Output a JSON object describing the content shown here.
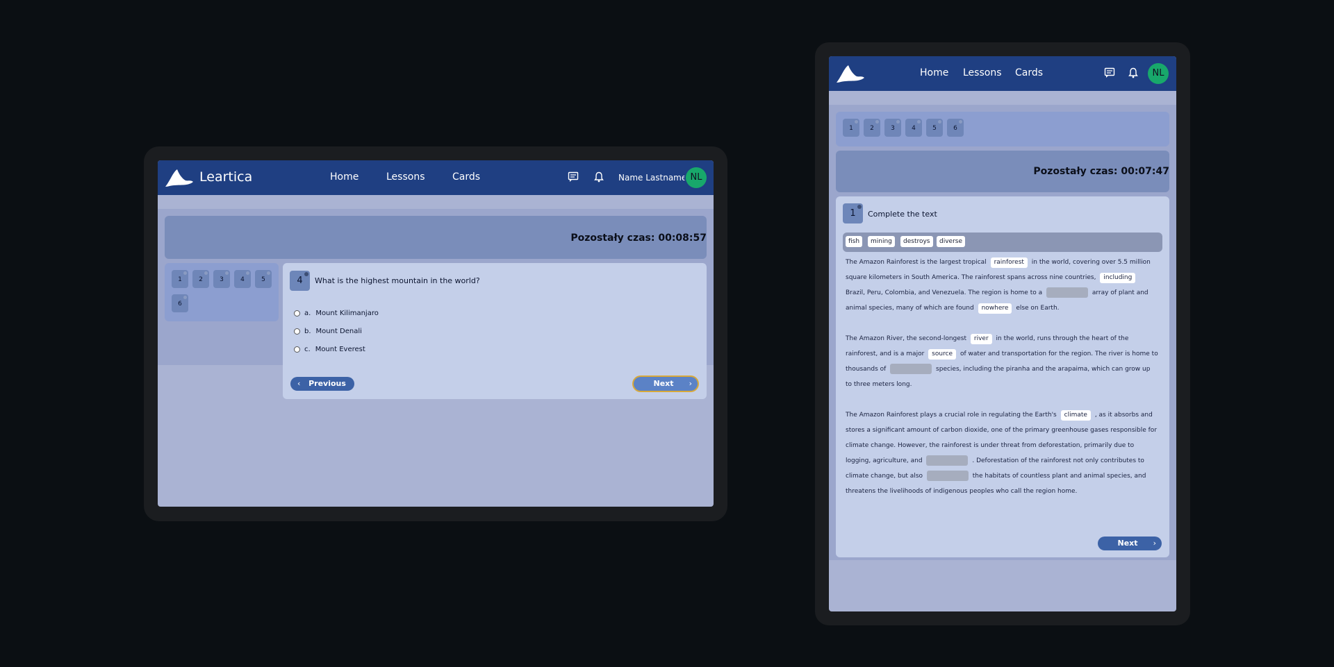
{
  "colors": {
    "navbar": "#1f3f82",
    "accent_button": "#3c62a6",
    "avatar": "#18a86b",
    "focus_outline": "#d8a93a"
  },
  "left": {
    "nav": {
      "brand": "Leartica",
      "links": [
        "Home",
        "Lessons",
        "Cards"
      ],
      "username": "Name Lastname",
      "avatar_initials": "NL"
    },
    "timer": "Pozostały czas: 00:08:57",
    "questions": [
      "1",
      "2",
      "3",
      "4",
      "5",
      "6"
    ],
    "current": {
      "number": "4",
      "text": "What is the highest mountain in the world?"
    },
    "options": [
      {
        "letter": "a.",
        "text": "Mount Kilimanjaro"
      },
      {
        "letter": "b.",
        "text": "Mount Denali"
      },
      {
        "letter": "c.",
        "text": "Mount Everest"
      }
    ],
    "prev_label": "Previous",
    "next_label": "Next"
  },
  "right": {
    "nav": {
      "links": [
        "Home",
        "Lessons",
        "Cards"
      ],
      "avatar_initials": "NL"
    },
    "questions": [
      "1",
      "2",
      "3",
      "4",
      "5",
      "6"
    ],
    "timer": "Pozostały czas: 00:07:47",
    "current": {
      "number": "1",
      "text": "Complete the text"
    },
    "word_bank": [
      "fish",
      "mining",
      "destroys",
      "diverse"
    ],
    "paragraph1": {
      "t1": "The Amazon Rainforest is the largest tropical",
      "f1": "rainforest",
      "t2": "in the world, covering over 5.5 million square kilometers in South America. The rainforest spans across nine countries,",
      "f2": "including",
      "t3": "Brazil, Peru, Colombia, and Venezuela. The region is home to a",
      "t4": "array of plant and animal species, many of which are found",
      "f3": "nowhere",
      "t5": "else on Earth."
    },
    "paragraph2": {
      "t1": "The Amazon River, the second-longest",
      "f1": "river",
      "t2": "in the world, runs through the heart of the rainforest, and is a major",
      "f2": "source",
      "t3": "of water and transportation for the region. The river is home to thousands of",
      "t4": "species, including the piranha and the arapaima, which can grow up to three meters long."
    },
    "paragraph3": {
      "t1": "The Amazon Rainforest plays a crucial role in regulating the Earth's",
      "f1": "climate",
      "t2": ", as it absorbs and stores a significant amount of carbon dioxide, one of the primary greenhouse gases responsible for climate change. However, the rainforest is under threat from deforestation, primarily due to logging, agriculture, and",
      "t3": ". Deforestation of the rainforest not only contributes to climate change, but also",
      "t4": "the habitats of countless plant and animal species, and threatens the livelihoods of indigenous peoples who call the region home."
    },
    "next_label": "Next"
  }
}
